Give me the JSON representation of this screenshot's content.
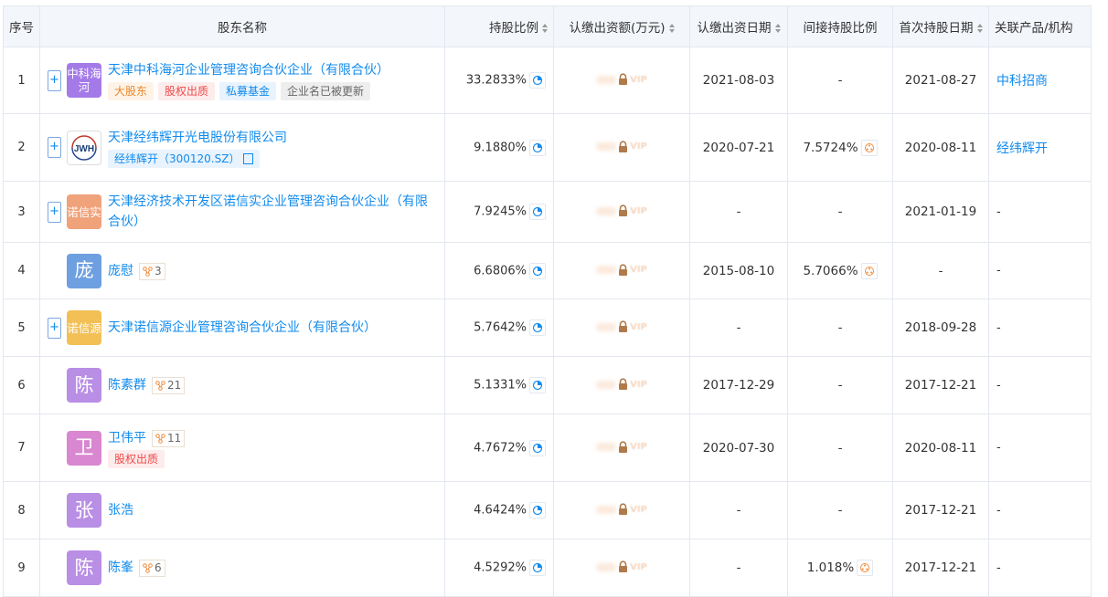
{
  "headers": {
    "seq": "序号",
    "name": "股东名称",
    "ratio": "持股比例",
    "capital": "认缴出资额(万元)",
    "capital_date": "认缴出资日期",
    "indirect": "间接持股比例",
    "first_date": "首次持股日期",
    "related": "关联产品/机构"
  },
  "vip_text": "VIP",
  "rows": [
    {
      "seq": "1",
      "logo": "中科海河",
      "logo_color": "#a47ae8",
      "name": "天津中科海河企业管理咨询合伙企业（有限合伙）",
      "tags": [
        {
          "text": "大股东",
          "style": "orange"
        },
        {
          "text": "股权出质",
          "style": "red"
        },
        {
          "text": "私募基金",
          "style": "blue"
        },
        {
          "text": "企业名已被更新",
          "style": "gray"
        }
      ],
      "ratio": "33.2833%",
      "capital_date": "2021-08-03",
      "indirect": "-",
      "first_date": "2021-08-27",
      "related": "中科招商"
    },
    {
      "seq": "2",
      "logo": "JWH",
      "logo_color": "#ffffff",
      "name": "天津经纬辉开光电股份有限公司",
      "tags": [
        {
          "text": "经纬辉开（300120.SZ）",
          "style": "blue"
        }
      ],
      "ratio": "9.1880%",
      "capital_date": "2020-07-21",
      "indirect": "7.5724%",
      "first_date": "2020-08-11",
      "related": "经纬辉开"
    },
    {
      "seq": "3",
      "logo": "诺信实",
      "logo_color": "#f0a27a",
      "name": "天津经济技术开发区诺信实企业管理咨询合伙企业（有限合伙）",
      "tags": [],
      "ratio": "7.9245%",
      "capital_date": "-",
      "indirect": "-",
      "first_date": "2021-01-19",
      "related": "-"
    },
    {
      "seq": "4",
      "logo": "庞",
      "logo_color": "#6e9fe0",
      "name": "庞慰",
      "rel": "3",
      "tags": [],
      "ratio": "6.6806%",
      "capital_date": "2015-08-10",
      "indirect": "5.7066%",
      "first_date": "-",
      "related": "-"
    },
    {
      "seq": "5",
      "logo": "诺信源",
      "logo_color": "#f2c055",
      "name": "天津诺信源企业管理咨询合伙企业（有限合伙）",
      "tags": [],
      "ratio": "5.7642%",
      "capital_date": "-",
      "indirect": "-",
      "first_date": "2018-09-28",
      "related": "-"
    },
    {
      "seq": "6",
      "logo": "陈",
      "logo_color": "#b98ee5",
      "name": "陈素群",
      "rel": "21",
      "tags": [],
      "ratio": "5.1331%",
      "capital_date": "2017-12-29",
      "indirect": "-",
      "first_date": "2017-12-21",
      "related": "-"
    },
    {
      "seq": "7",
      "logo": "卫",
      "logo_color": "#d987d0",
      "name": "卫伟平",
      "rel": "11",
      "tags": [
        {
          "text": "股权出质",
          "style": "red"
        }
      ],
      "ratio": "4.7672%",
      "capital_date": "2020-07-30",
      "indirect": "-",
      "first_date": "2020-08-11",
      "related": "-"
    },
    {
      "seq": "8",
      "logo": "张",
      "logo_color": "#b98ee5",
      "name": "张浩",
      "tags": [],
      "ratio": "4.6424%",
      "capital_date": "-",
      "indirect": "-",
      "first_date": "2017-12-21",
      "related": "-"
    },
    {
      "seq": "9",
      "logo": "陈",
      "logo_color": "#b98ee5",
      "name": "陈峯",
      "rel": "6",
      "tags": [],
      "ratio": "4.5292%",
      "capital_date": "-",
      "indirect": "1.018%",
      "first_date": "2017-12-21",
      "related": "-"
    }
  ]
}
